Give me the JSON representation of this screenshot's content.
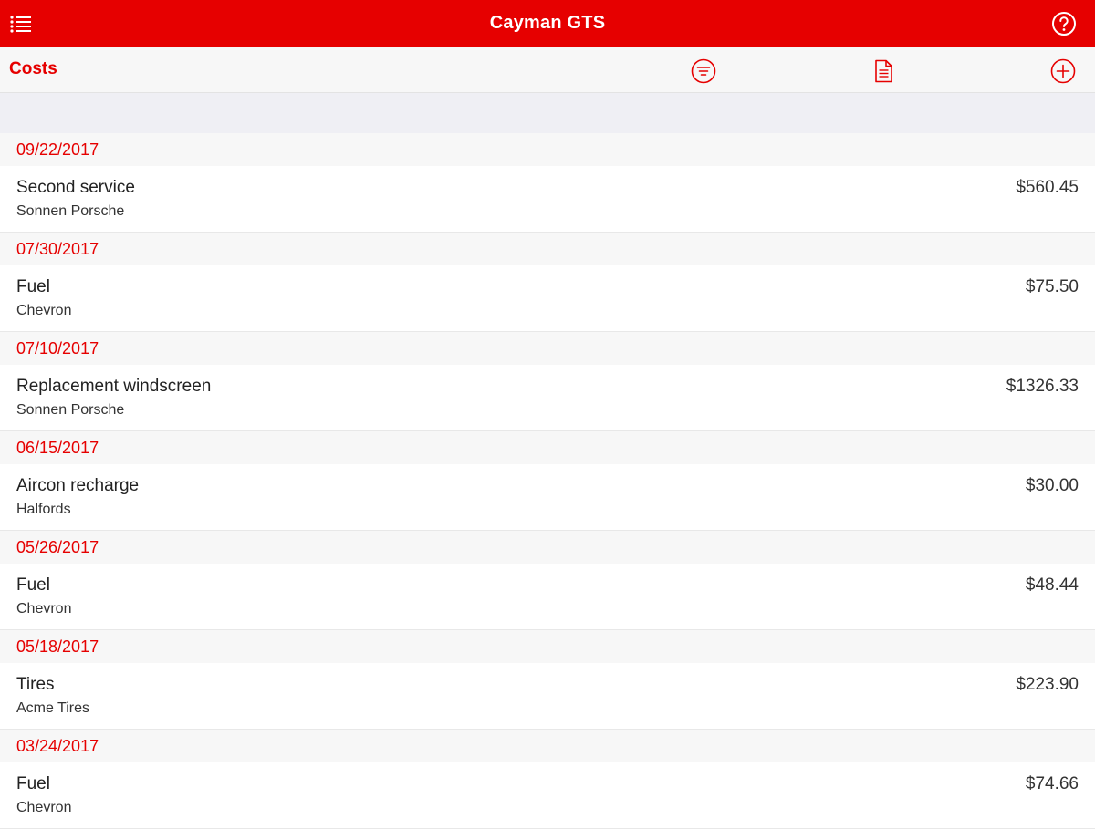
{
  "header": {
    "title": "Cayman GTS",
    "menu_icon": "list-menu-icon",
    "help_icon": "help-circle-icon"
  },
  "toolbar": {
    "section_title": "Costs",
    "filter_icon": "filter-icon",
    "report_icon": "document-icon",
    "add_icon": "add-circle-icon"
  },
  "colors": {
    "accent": "#e60000",
    "header_bg": "#f7f7f7",
    "spacer_bg": "#efeff4"
  },
  "costs": [
    {
      "date": "09/22/2017",
      "name": "Second service",
      "vendor": "Sonnen Porsche",
      "amount": "$560.45"
    },
    {
      "date": "07/30/2017",
      "name": "Fuel",
      "vendor": "Chevron",
      "amount": "$75.50"
    },
    {
      "date": "07/10/2017",
      "name": "Replacement windscreen",
      "vendor": "Sonnen Porsche",
      "amount": "$1326.33"
    },
    {
      "date": "06/15/2017",
      "name": "Aircon recharge",
      "vendor": "Halfords",
      "amount": "$30.00"
    },
    {
      "date": "05/26/2017",
      "name": "Fuel",
      "vendor": "Chevron",
      "amount": "$48.44"
    },
    {
      "date": "05/18/2017",
      "name": "Tires",
      "vendor": "Acme Tires",
      "amount": "$223.90"
    },
    {
      "date": "03/24/2017",
      "name": "Fuel",
      "vendor": "Chevron",
      "amount": "$74.66"
    }
  ]
}
